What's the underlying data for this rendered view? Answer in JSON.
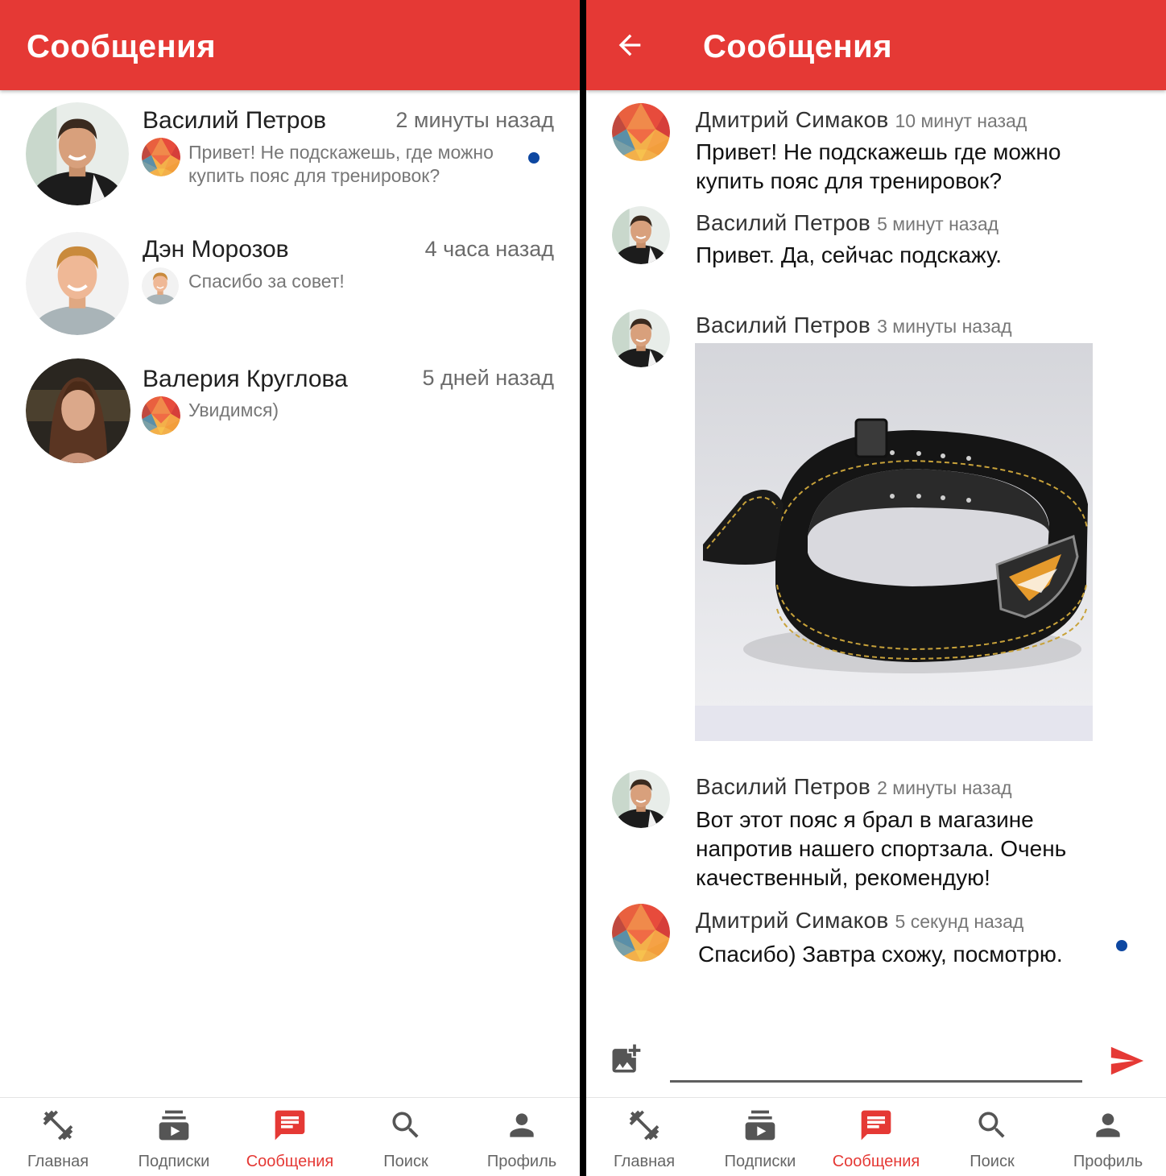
{
  "colors": {
    "primary": "#e53935",
    "unread": "#0d47a1",
    "active_nav": "#e53935"
  },
  "chat_list": {
    "title": "Сообщения",
    "items": [
      {
        "name": "Василий Петров",
        "time": "2 минуты назад",
        "preview": "Привет! Не подскажешь, где можно купить пояс для тренировок?",
        "unread": true
      },
      {
        "name": "Дэн Морозов",
        "time": "4 часа назад",
        "preview": "Спасибо за совет!",
        "unread": false
      },
      {
        "name": "Валерия Круглова",
        "time": "5 дней назад",
        "preview": "Увидимся)",
        "unread": false
      }
    ]
  },
  "conversation": {
    "title": "Сообщения",
    "messages": [
      {
        "author": "Дмитрий Симаков",
        "time": "10 минут назад",
        "text": "Привет! Не подскажешь где можно купить пояс для тренировок?"
      },
      {
        "author": "Василий Петров",
        "time": "5 минут назад",
        "text": "Привет. Да, сейчас подскажу."
      },
      {
        "author": "Василий Петров",
        "time": "3 минуты назад",
        "image": "belt-photo"
      },
      {
        "author": "Василий Петров",
        "time": "2 минуты назад",
        "text": "Вот этот пояс я брал в магазине напротив нашего спортзала. Очень качественный, рекомендую!"
      },
      {
        "author": "Дмитрий Симаков",
        "time": "5 секунд назад",
        "text": "Спасибо) Завтра схожу, посмотрю.",
        "unread": true
      }
    ],
    "composer": {
      "placeholder": ""
    }
  },
  "bottom_nav": {
    "items": [
      {
        "label": "Главная",
        "icon": "dumbbell-icon"
      },
      {
        "label": "Подписки",
        "icon": "subscriptions-icon"
      },
      {
        "label": "Сообщения",
        "icon": "message-icon",
        "active": true
      },
      {
        "label": "Поиск",
        "icon": "search-icon"
      },
      {
        "label": "Профиль",
        "icon": "person-icon"
      }
    ]
  }
}
